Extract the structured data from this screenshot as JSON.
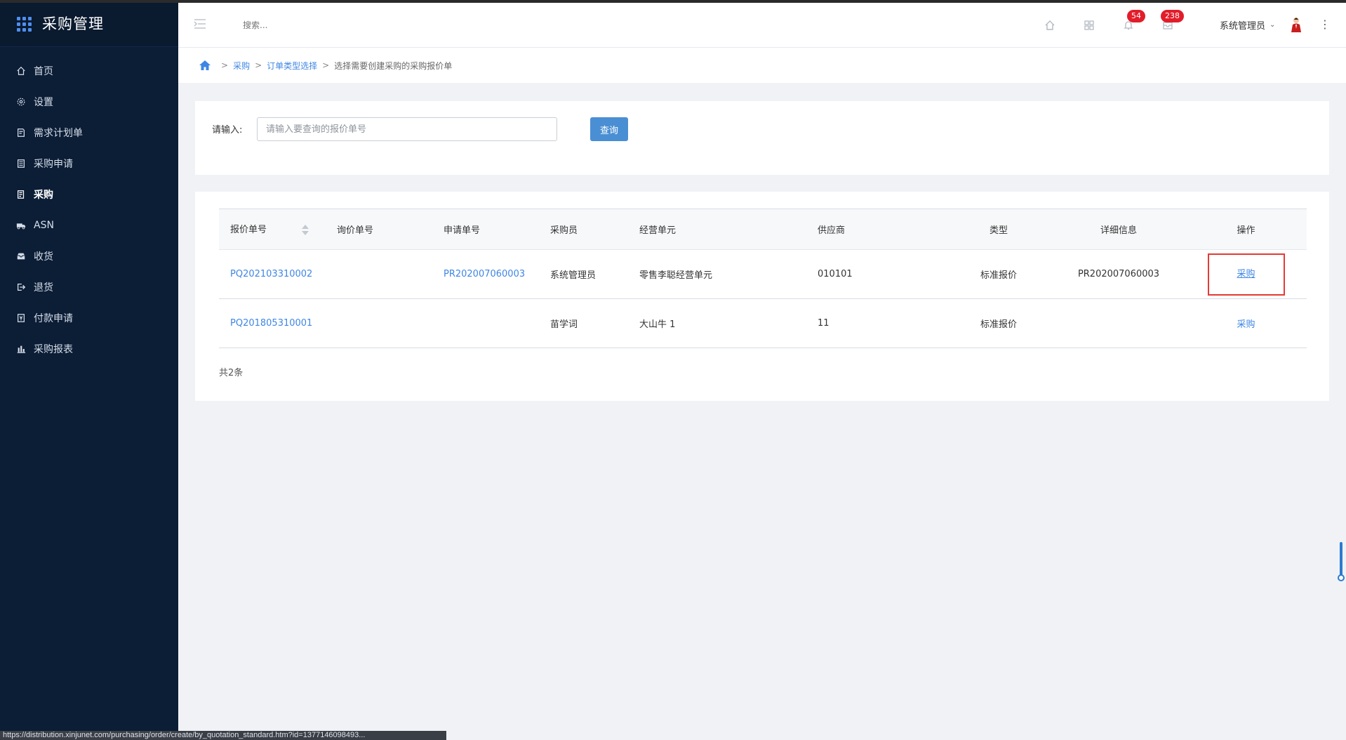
{
  "app": {
    "title": "采购管理"
  },
  "sidebar": {
    "items": [
      {
        "label": "首页",
        "icon": "home-icon"
      },
      {
        "label": "设置",
        "icon": "gear-icon"
      },
      {
        "label": "需求计划单",
        "icon": "document-icon"
      },
      {
        "label": "采购申请",
        "icon": "list-icon"
      },
      {
        "label": "采购",
        "icon": "cart-doc-icon",
        "active": true
      },
      {
        "label": "ASN",
        "icon": "truck-icon"
      },
      {
        "label": "收货",
        "icon": "inbox-icon"
      },
      {
        "label": "退货",
        "icon": "return-icon"
      },
      {
        "label": "付款申请",
        "icon": "payment-icon"
      },
      {
        "label": "采购报表",
        "icon": "bar-chart-icon"
      }
    ]
  },
  "header": {
    "search_placeholder": "搜索...",
    "notifications_count": "54",
    "messages_count": "238",
    "user_name": "系统管理员"
  },
  "breadcrumb": {
    "items": [
      "采购",
      "订单类型选择"
    ],
    "current": "选择需要创建采购的采购报价单",
    "separator": ">"
  },
  "search": {
    "label": "请输入:",
    "placeholder": "请输入要查询的报价单号",
    "button": "查询"
  },
  "table": {
    "columns": [
      "报价单号",
      "询价单号",
      "申请单号",
      "采购员",
      "经营单元",
      "供应商",
      "类型",
      "详细信息",
      "操作"
    ],
    "rows": [
      {
        "quote_no": "PQ202103310002",
        "inquiry_no": "",
        "request_no": "PR202007060003",
        "buyer": "系统管理员",
        "unit": "零售李聪经营单元",
        "supplier": "010101",
        "type": "标准报价",
        "detail": "PR202007060003",
        "action": "采购"
      },
      {
        "quote_no": "PQ201805310001",
        "inquiry_no": "",
        "request_no": "",
        "buyer": "苗学词",
        "unit": "大山牛 1",
        "supplier": "11",
        "type": "标准报价",
        "detail": "",
        "action": "采购"
      }
    ],
    "total": "共2条"
  },
  "status_url": "https://distribution.xinjunet.com/purchasing/order/create/by_quotation_standard.htm?id=1377146098493...",
  "colors": {
    "sidebar_bg": "#0c1e36",
    "accent": "#3f86e4",
    "button": "#4a8fd3",
    "badge": "#e21d2a",
    "highlight": "#e53935"
  }
}
